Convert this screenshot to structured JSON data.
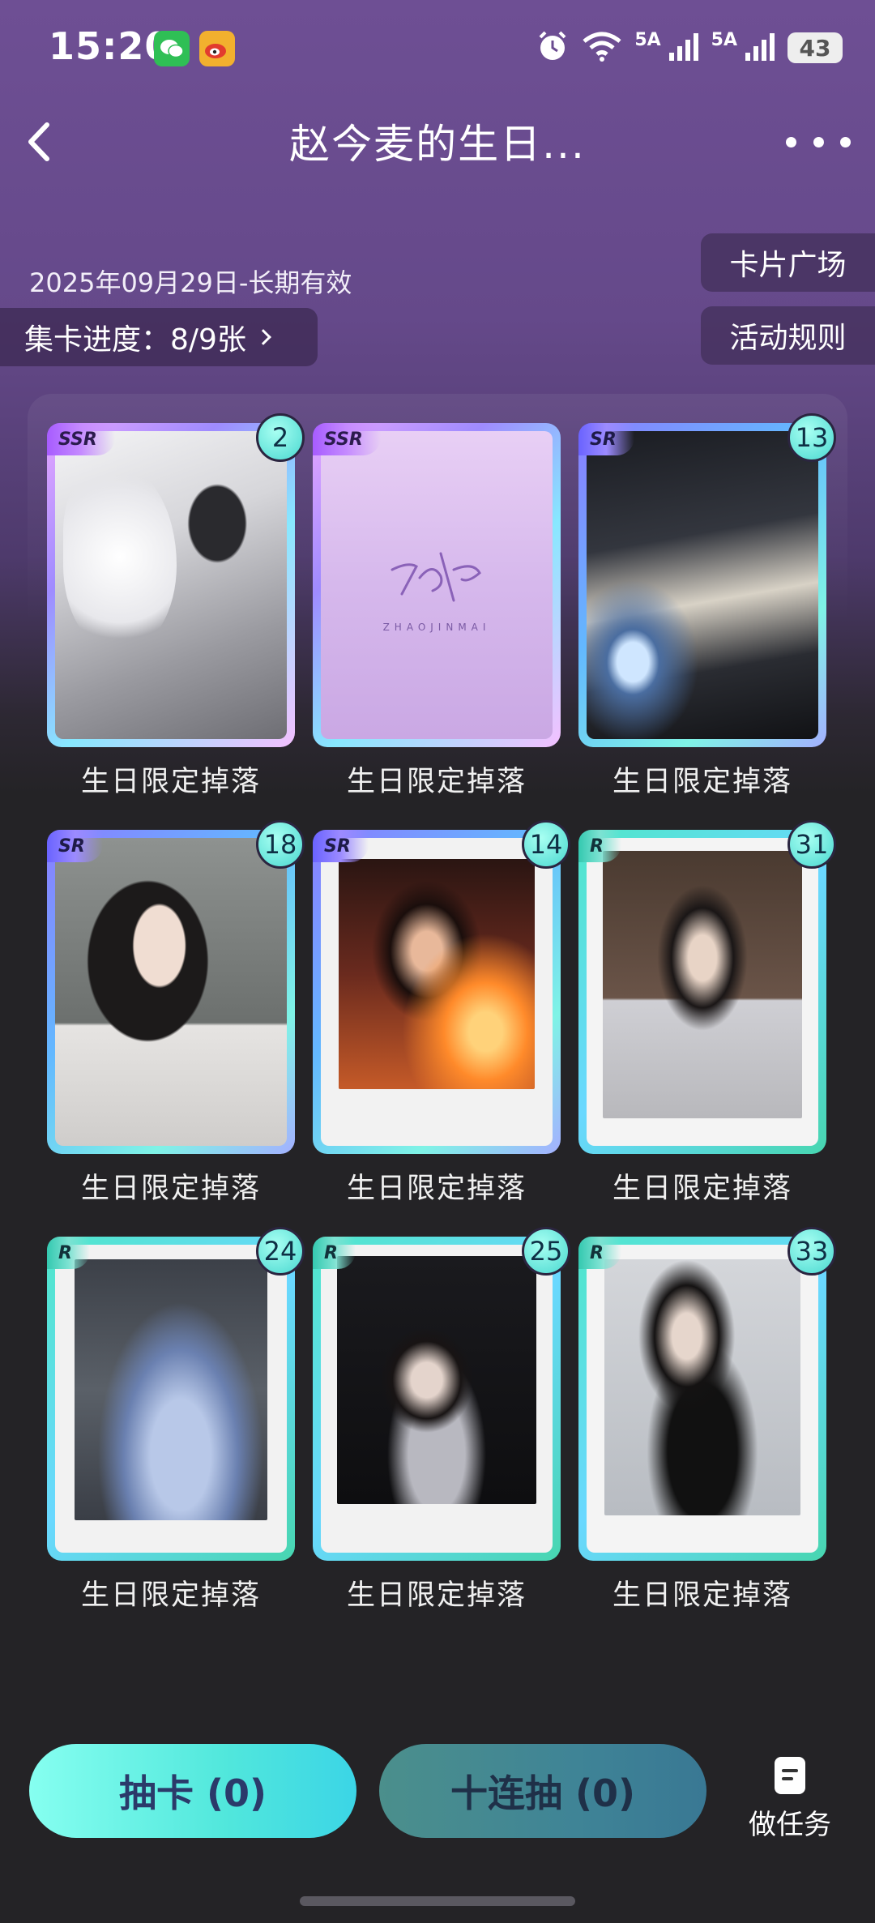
{
  "status_bar": {
    "time": "15:20",
    "sim1": "5A",
    "sim2": "5A",
    "battery": "43",
    "icons": [
      "wechat-icon",
      "weibo-icon",
      "alarm-icon",
      "wifi-icon",
      "signal-icon",
      "battery-icon"
    ]
  },
  "header": {
    "title": "赵今麦的生日...",
    "back_icon": "chevron-left-icon",
    "more_icon": "more-dots-icon"
  },
  "event": {
    "validity": "2025年09月29日-长期有效",
    "progress_label": "集卡进度：8/9张",
    "plaza_button": "卡片广场",
    "rules_button": "活动规则"
  },
  "cards": [
    {
      "rarity": "SSR",
      "count": "2",
      "caption": "生日限定掉落"
    },
    {
      "rarity": "SSR",
      "count": "",
      "caption": "生日限定掉落"
    },
    {
      "rarity": "SR",
      "count": "13",
      "caption": "生日限定掉落"
    },
    {
      "rarity": "SR",
      "count": "18",
      "caption": "生日限定掉落"
    },
    {
      "rarity": "SR",
      "count": "14",
      "caption": "生日限定掉落"
    },
    {
      "rarity": "R",
      "count": "31",
      "caption": "生日限定掉落"
    },
    {
      "rarity": "R",
      "count": "24",
      "caption": "生日限定掉落"
    },
    {
      "rarity": "R",
      "count": "25",
      "caption": "生日限定掉落"
    },
    {
      "rarity": "R",
      "count": "33",
      "caption": "生日限定掉落"
    }
  ],
  "signature_card": {
    "sub": "ZHAOJINMAI"
  },
  "bottom": {
    "draw_one": "抽卡 (0)",
    "draw_ten": "十连抽 (0)",
    "task_label": "做任务"
  },
  "colors": {
    "bg_top": "#6e4f94",
    "bg_bottom": "#242326",
    "accent_teal": "#51e7dc"
  }
}
